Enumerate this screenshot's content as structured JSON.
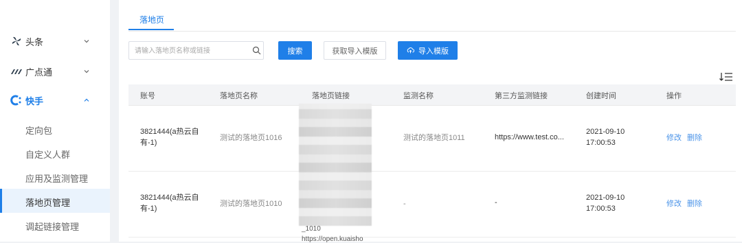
{
  "sidebar": {
    "groups": [
      {
        "label": "头条",
        "icon": "toutiao-pinwheel-icon",
        "expanded": false
      },
      {
        "label": "广点通",
        "icon": "guangdiantong-logo-icon",
        "expanded": false
      },
      {
        "label": "快手",
        "icon": "kuaishou-logo-icon",
        "expanded": true
      }
    ],
    "sub_items": [
      {
        "label": "定向包"
      },
      {
        "label": "自定义人群"
      },
      {
        "label": "应用及监测管理"
      },
      {
        "label": "落地页管理",
        "selected": true
      },
      {
        "label": "调起链接管理"
      }
    ]
  },
  "tabs": [
    {
      "label": "落地页"
    }
  ],
  "toolbar": {
    "search_placeholder": "请输入落地页名称或链接",
    "search_value": "",
    "search_button": "搜索",
    "fetch_template_button": "获取导入模版",
    "import_template_button": "导入模版"
  },
  "table": {
    "columns": [
      "账号",
      "落地页名称",
      "落地页链接",
      "监测名称",
      "第三方监测链接",
      "创建时间",
      "操作"
    ],
    "rows": [
      {
        "account": "3821444(a热云自有-1)",
        "page_name": "测试的落地页1016",
        "page_link": "",
        "monitor_name": "测试的落地页1011",
        "third_party_link": "https://www.test.co...",
        "created_at": "2021-09-10 17:00:53",
        "edit": "修改",
        "delete": "删除"
      },
      {
        "account": "3821444(a热云自有-1)",
        "page_name": "测试的落地页1010",
        "page_link": "",
        "monitor_name": "-",
        "third_party_link": "-",
        "created_at": "2021-09-10 17:00:53",
        "edit": "修改",
        "delete": "删除"
      }
    ],
    "link_tail_1": "_1010",
    "link_tail_2": "https://open.kuaisho"
  },
  "colors": {
    "primary": "#1f7fe8",
    "link": "#4c94e8",
    "header_bg": "#f3f4f6",
    "page_bg": "#f0f2f5"
  }
}
